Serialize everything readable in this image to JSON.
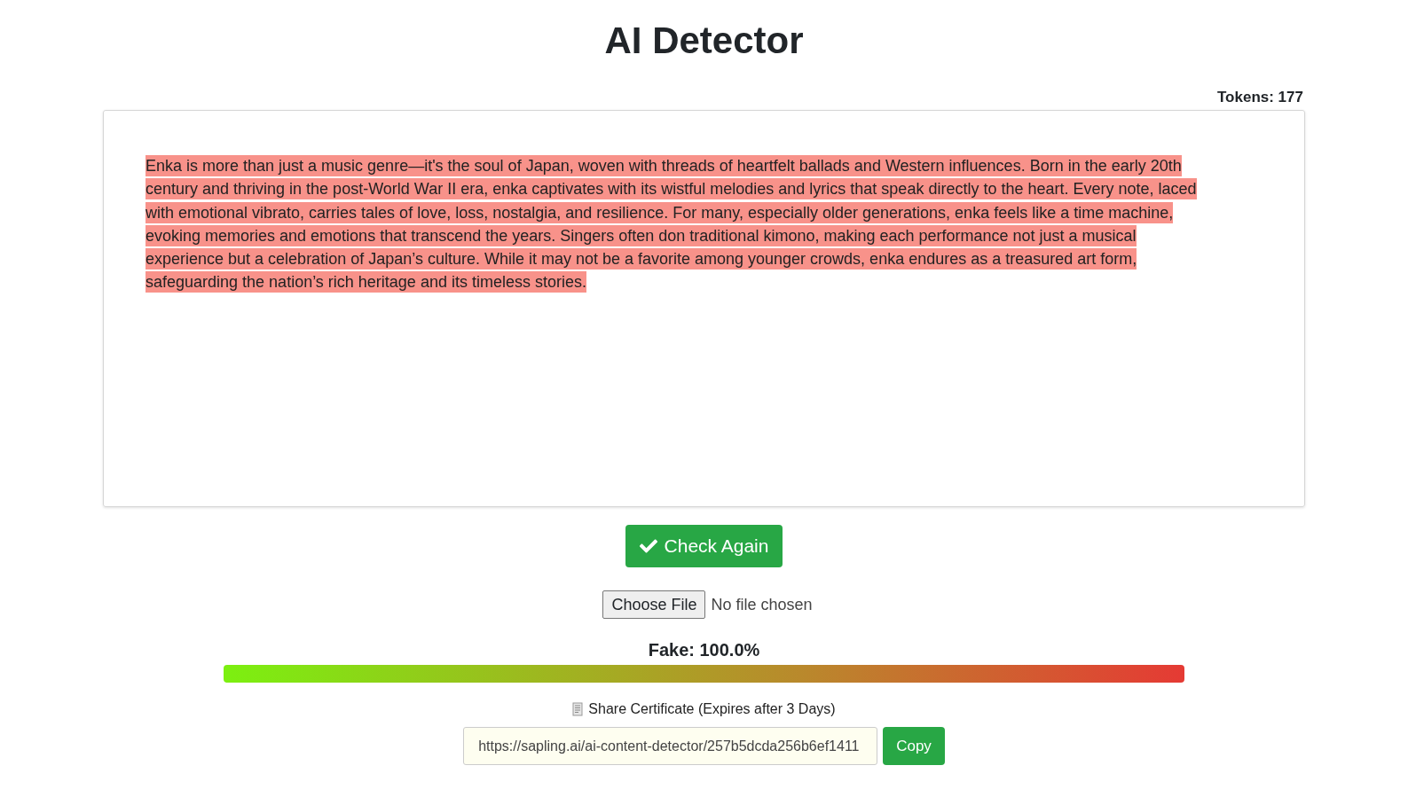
{
  "title": "AI Detector",
  "tokens": "Tokens: 177",
  "passage": {
    "text": "Enka is more than just a music genre—it's the soul of Japan, woven with threads of heartfelt ballads and Western influences. Born in the early 20th century and thriving in the post-World War II era, enka captivates with its wistful melodies and lyrics that speak directly to the heart. Every note, laced with emotional vibrato, carries tales of love, loss, nostalgia, and resilience. For many, especially older generations, enka feels like a time machine, evoking memories and emotions that transcend the years. Singers often don traditional kimono, making each performance not just a musical experience but a celebration of Japan’s culture. While it may not be a favorite among younger crowds, enka endures as a treasured art form, safeguarding the nation’s rich heritage and its timeless stories.",
    "highlighted": true
  },
  "check_button": "Check Again",
  "file_input": {
    "button": "Choose File",
    "status": "No file chosen"
  },
  "result": {
    "label": "Fake: 100.0%"
  },
  "share": {
    "label": "Share Certificate (Expires after 3 Days)",
    "url": "https://sapling.ai/ai-content-detector/257b5dcda256b6ef1411",
    "copy_button": "Copy"
  }
}
